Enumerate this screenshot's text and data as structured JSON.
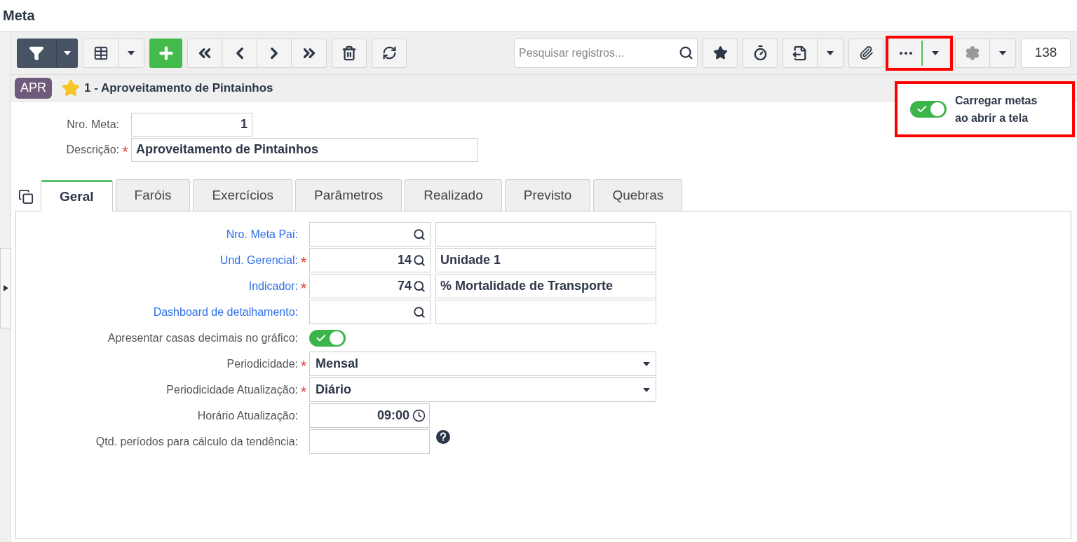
{
  "page_title": "Meta",
  "toolbar": {
    "search": {
      "placeholder": "Pesquisar registros..."
    },
    "record_count": "138",
    "more_highlighted": true
  },
  "popover": {
    "highlighted": true,
    "toggle_on": true,
    "label": "Carregar metas ao abrir a tela"
  },
  "record": {
    "badge": "APR",
    "favorite": true,
    "title": "1 - Aproveitamento de Pintainhos"
  },
  "header_fields": [
    {
      "label": "Nro. Meta:",
      "value": "1",
      "kind": "number"
    },
    {
      "label": "Descrição:",
      "required_mark": "*",
      "value": "Aproveitamento de Pintainhos",
      "kind": "text"
    }
  ],
  "tabs": [
    {
      "label": "Geral",
      "selected": true
    },
    {
      "label": "Faróis",
      "selected": false
    },
    {
      "label": "Exercícios",
      "selected": false
    },
    {
      "label": "Parâmetros",
      "selected": false
    },
    {
      "label": "Realizado",
      "selected": false
    },
    {
      "label": "Previsto",
      "selected": false
    },
    {
      "label": "Quebras",
      "selected": false
    }
  ],
  "fields": [
    {
      "kind": "lookup",
      "label": "Nro. Meta Pai:"
    },
    {
      "kind": "lookup",
      "label": "Und. Gerencial:",
      "required_mark": "*",
      "code": "14",
      "description": "Unidade 1"
    },
    {
      "kind": "lookup",
      "label": "Indicador:",
      "required_mark": "*",
      "code": "74",
      "description": "% Mortalidade de Transporte"
    },
    {
      "kind": "lookup",
      "label": "Dashboard de detalhamento:"
    },
    {
      "kind": "toggle",
      "label": "Apresentar casas decimais no gráfico:",
      "on": true
    },
    {
      "kind": "select",
      "label": "Periodicidade:",
      "required_mark": "*",
      "value": "Mensal"
    },
    {
      "kind": "select",
      "label": "Periodicidade Atualização:",
      "required_mark": "*",
      "value": "Diário"
    },
    {
      "kind": "time",
      "label": "Horário Atualização:",
      "value": "09:00"
    },
    {
      "kind": "number_help",
      "label": "Qtd. períodos para cálculo da tendência:"
    }
  ]
}
